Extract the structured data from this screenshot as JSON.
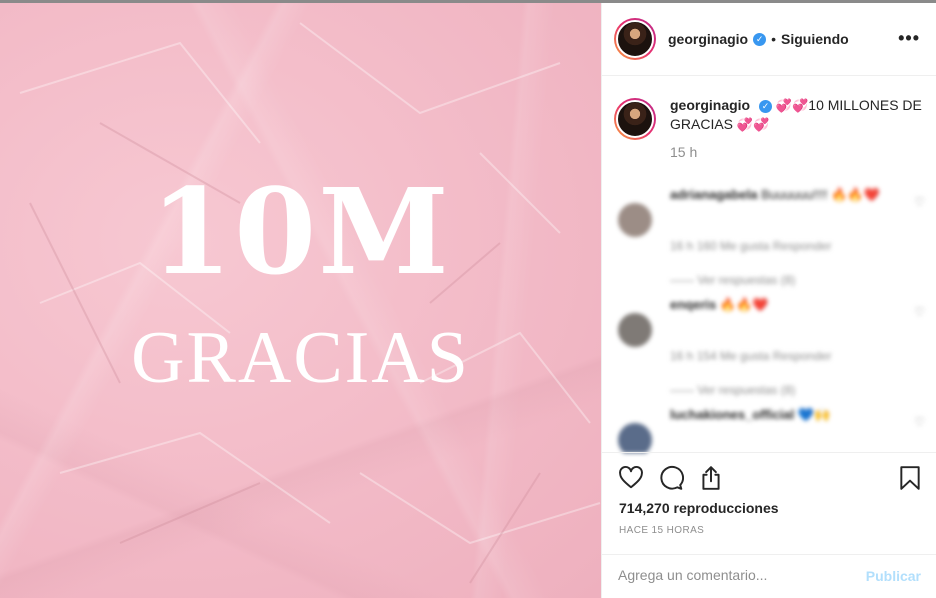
{
  "post": {
    "headline_number": "10M",
    "headline_word": "GRACIAS"
  },
  "header": {
    "username": "georginagio",
    "dot": "•",
    "follow_status": "Siguiendo",
    "more": "•••"
  },
  "caption": {
    "username": "georginagio",
    "hearts_before": "💞💞",
    "text": "10 MILLONES DE GRACIAS",
    "hearts_after": "💞💞",
    "time": "15 h"
  },
  "comments": [
    {
      "user": "adrianagabela",
      "text": "Buuuuuu!!!!",
      "emoji": "🔥🔥❤️",
      "meta": "16 h   160 Me gusta   Responder",
      "replies": "——  Ver respuestas (8)"
    },
    {
      "user": "enqeris",
      "text": "",
      "emoji": "🔥🔥❤️",
      "meta": "16 h   154 Me gusta   Responder",
      "replies": "——  Ver respuestas (8)"
    },
    {
      "user": "luchakiones_official",
      "text": "",
      "emoji": "💙🙌",
      "meta": "",
      "replies": ""
    }
  ],
  "actions": {
    "views": "714,270 reproducciones",
    "time_ago": "HACE 15 HORAS",
    "comment_placeholder": "Agrega un comentario...",
    "publish": "Publicar"
  },
  "icons": [
    "heart-icon",
    "comment-icon",
    "share-icon",
    "bookmark-icon",
    "verified-badge-icon",
    "more-options-icon"
  ],
  "colors": {
    "accent": "#3897f0",
    "media_pink": "#f2b9c6",
    "publish_disabled": "#b2dffc"
  }
}
